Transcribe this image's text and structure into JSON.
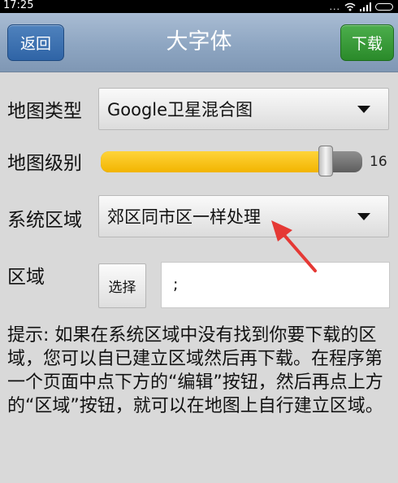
{
  "status_bar": {
    "time": "17:25",
    "dots": "..."
  },
  "header": {
    "back_label": "返回",
    "title": "大字体",
    "download_label": "下载"
  },
  "map_type": {
    "label": "地图类型",
    "value": "Google卫星混合图"
  },
  "map_level": {
    "label": "地图级别",
    "value_text": "16",
    "fraction": 0.86
  },
  "system_region": {
    "label": "系统区域",
    "value": "郊区同市区一样处理"
  },
  "region": {
    "label": "区域",
    "select_label": "选择",
    "value": ";"
  },
  "hint": "提示: 如果在系统区域中没有找到你要下载的区域，您可以自已建立区域然后再下载。在程序第一个页面中点下方的“编辑”按钮，然后再点上方的“区域”按钮，就可以在地图上自行建立区域。",
  "colors": {
    "slider_fill": "#f5c000",
    "download_button": "#2f8f2f",
    "back_button": "#3569ab",
    "annotation_arrow": "#e53935"
  }
}
